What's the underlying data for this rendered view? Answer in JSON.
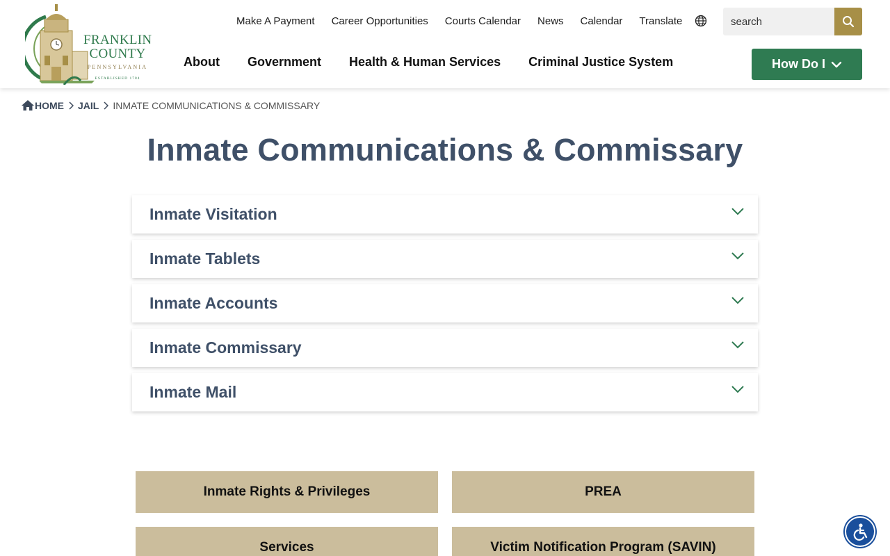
{
  "logo": {
    "line1": "FRANKLIN",
    "line2": "COUNTY",
    "line3": "PENNSYLVANIA",
    "line4": "ESTABLISHED 1784"
  },
  "utility_nav": [
    "Make A Payment",
    "Career Opportunities",
    "Courts Calendar",
    "News",
    "Calendar",
    "Translate"
  ],
  "search": {
    "placeholder": "search"
  },
  "main_nav": [
    "About",
    "Government",
    "Health & Human Services",
    "Criminal Justice System"
  ],
  "how_do_i": "How Do I",
  "breadcrumb": {
    "home": "HOME",
    "parent": "JAIL",
    "current": "INMATE COMMUNICATIONS & COMMISSARY"
  },
  "page_title": "Inmate Communications & Commissary",
  "accordion": [
    "Inmate Visitation",
    "Inmate Tablets",
    "Inmate Accounts",
    "Inmate Commissary",
    "Inmate Mail"
  ],
  "tiles": [
    "Inmate Rights & Privileges",
    "PREA",
    "Services",
    "Victim Notification Program (SAVIN)"
  ],
  "colors": {
    "brand_green": "#2f7b52",
    "gold": "#a78f47",
    "tile_tan": "#cbbd9c",
    "heading": "#3f5068"
  }
}
